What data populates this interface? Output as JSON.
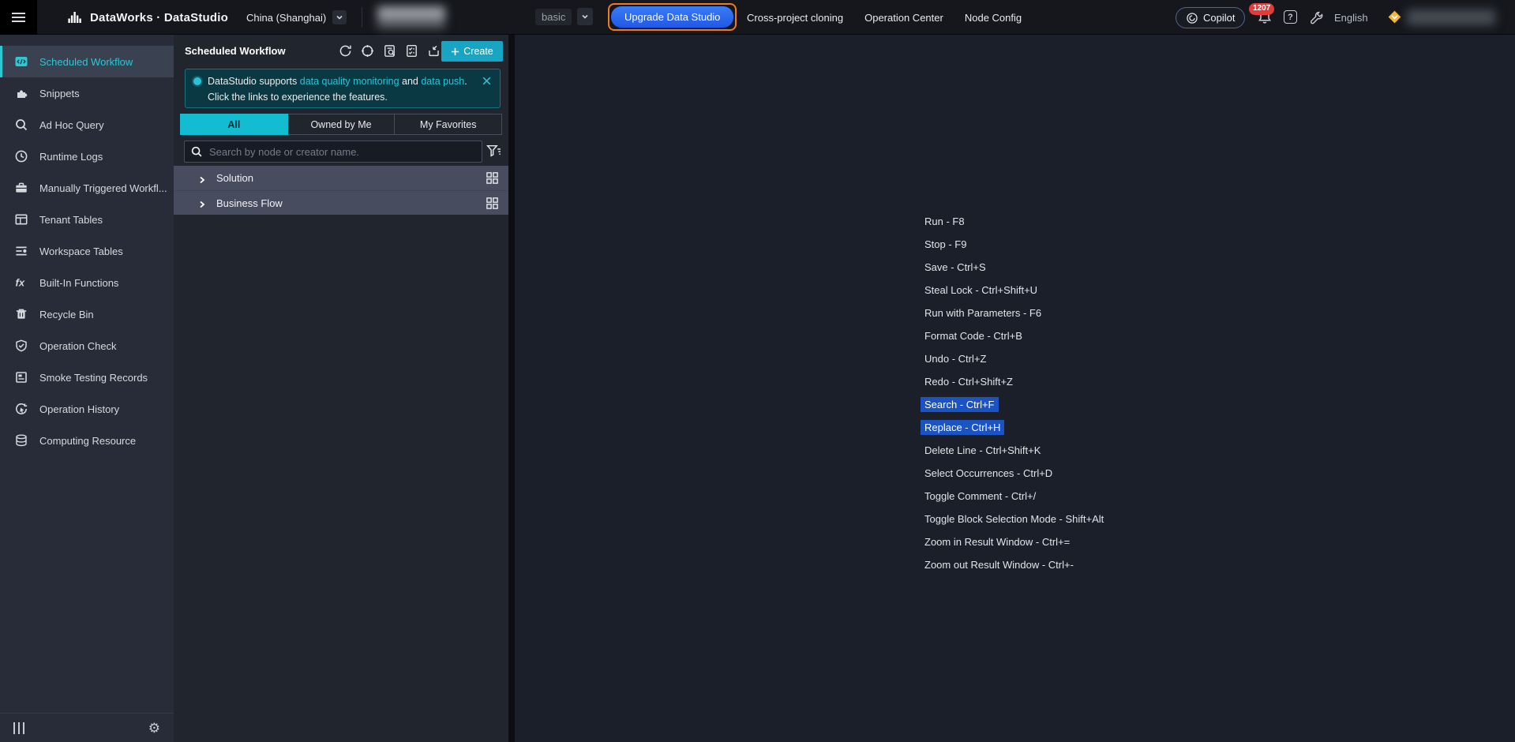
{
  "topbar": {
    "brand": "DataWorks · DataStudio",
    "region": "China (Shanghai)",
    "mode": "basic",
    "upgrade_button": "Upgrade Data Studio",
    "nav": [
      "Cross-project cloning",
      "Operation Center",
      "Node Config"
    ],
    "copilot_label": "Copilot",
    "notification_count": "1207",
    "help_glyph": "?",
    "language": "English"
  },
  "sidebar": {
    "items": [
      {
        "label": "Scheduled Workflow",
        "icon": "code",
        "active": true
      },
      {
        "label": "Snippets",
        "icon": "puzzle",
        "active": false
      },
      {
        "label": "Ad Hoc Query",
        "icon": "search",
        "active": false
      },
      {
        "label": "Runtime Logs",
        "icon": "clock",
        "active": false
      },
      {
        "label": "Manually Triggered Workfl...",
        "icon": "briefcase",
        "active": false
      },
      {
        "label": "Tenant Tables",
        "icon": "table",
        "active": false
      },
      {
        "label": "Workspace Tables",
        "icon": "list-db",
        "active": false
      },
      {
        "label": "Built-In Functions",
        "icon": "fx",
        "active": false
      },
      {
        "label": "Recycle Bin",
        "icon": "trash",
        "active": false
      },
      {
        "label": "Operation Check",
        "icon": "shield-check",
        "active": false
      },
      {
        "label": "Smoke Testing Records",
        "icon": "doc",
        "active": false
      },
      {
        "label": "Operation History",
        "icon": "history",
        "active": false
      },
      {
        "label": "Computing Resource",
        "icon": "database",
        "active": false
      }
    ]
  },
  "panel": {
    "title": "Scheduled Workflow",
    "create_label": "Create",
    "banner": {
      "lead": "DataStudio supports ",
      "link_quality": "data quality monitoring",
      "mid": " and ",
      "link_push": "data push",
      "tail": ". Click the links to experience the features."
    },
    "tabs": [
      {
        "label": "All",
        "active": true
      },
      {
        "label": "Owned by Me",
        "active": false
      },
      {
        "label": "My Favorites",
        "active": false
      }
    ],
    "search_placeholder": "Search by node or creator name.",
    "tree": [
      {
        "label": "Solution"
      },
      {
        "label": "Business Flow"
      }
    ]
  },
  "shortcuts": [
    {
      "label": "Run - F8",
      "highlighted": false
    },
    {
      "label": "Stop - F9",
      "highlighted": false
    },
    {
      "label": "Save - Ctrl+S",
      "highlighted": false
    },
    {
      "label": "Steal Lock - Ctrl+Shift+U",
      "highlighted": false
    },
    {
      "label": "Run with Parameters - F6",
      "highlighted": false
    },
    {
      "label": "Format Code - Ctrl+B",
      "highlighted": false
    },
    {
      "label": "Undo - Ctrl+Z",
      "highlighted": false
    },
    {
      "label": "Redo - Ctrl+Shift+Z",
      "highlighted": false
    },
    {
      "label": "Search - Ctrl+F",
      "highlighted": true
    },
    {
      "label": "Replace - Ctrl+H",
      "highlighted": true
    },
    {
      "label": "Delete Line - Ctrl+Shift+K",
      "highlighted": false
    },
    {
      "label": "Select Occurrences - Ctrl+D",
      "highlighted": false
    },
    {
      "label": "Toggle Comment - Ctrl+/",
      "highlighted": false
    },
    {
      "label": "Toggle Block Selection Mode - Shift+Alt",
      "highlighted": false
    },
    {
      "label": "Zoom in Result Window - Ctrl+=",
      "highlighted": false
    },
    {
      "label": "Zoom out Result Window - Ctrl+-",
      "highlighted": false
    }
  ],
  "colors": {
    "accent_cyan": "#12bdd2",
    "highlight_blue": "#1c53c3",
    "upgrade_border_orange": "#ed7b1f",
    "badge_red": "#e13c3c",
    "vip_gold": "#f5b637",
    "banner_teal": "#0a3944"
  }
}
